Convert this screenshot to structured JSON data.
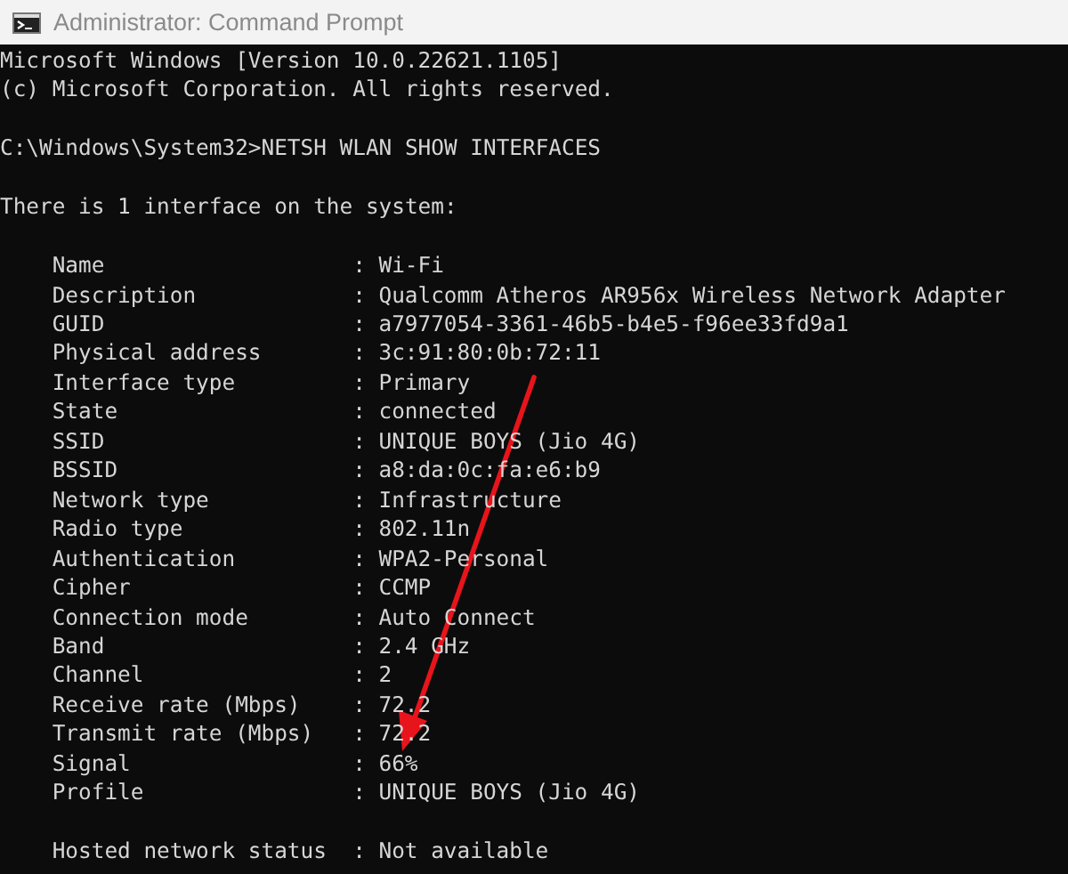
{
  "window": {
    "title": "Administrator: Command Prompt"
  },
  "console": {
    "header_lines": [
      "Microsoft Windows [Version 10.0.22621.1105]",
      "(c) Microsoft Corporation. All rights reserved."
    ],
    "command": "C:\\Windows\\System32>NETSH WLAN SHOW INTERFACES",
    "summary": "There is 1 interface on the system:",
    "fields": [
      {
        "label": "Name",
        "separator": ":",
        "value": "Wi-Fi"
      },
      {
        "label": "Description",
        "separator": ":",
        "value": "Qualcomm Atheros AR956x Wireless Network Adapter"
      },
      {
        "label": "GUID",
        "separator": ":",
        "value": "a7977054-3361-46b5-b4e5-f96ee33fd9a1"
      },
      {
        "label": "Physical address",
        "separator": ":",
        "value": "3c:91:80:0b:72:11"
      },
      {
        "label": "Interface type",
        "separator": ":",
        "value": "Primary"
      },
      {
        "label": "State",
        "separator": ":",
        "value": "connected"
      },
      {
        "label": "SSID",
        "separator": ":",
        "value": "UNIQUE BOYS (Jio 4G)"
      },
      {
        "label": "BSSID",
        "separator": ":",
        "value": "a8:da:0c:fa:e6:b9"
      },
      {
        "label": "Network type",
        "separator": ":",
        "value": "Infrastructure"
      },
      {
        "label": "Radio type",
        "separator": ":",
        "value": "802.11n"
      },
      {
        "label": "Authentication",
        "separator": ":",
        "value": "WPA2-Personal"
      },
      {
        "label": "Cipher",
        "separator": ":",
        "value": "CCMP"
      },
      {
        "label": "Connection mode",
        "separator": ":",
        "value": "Auto Connect"
      },
      {
        "label": "Band",
        "separator": ":",
        "value": "2.4 GHz"
      },
      {
        "label": "Channel",
        "separator": ":",
        "value": "2"
      },
      {
        "label": "Receive rate (Mbps)",
        "separator": ":",
        "value": "72.2"
      },
      {
        "label": "Transmit rate (Mbps)",
        "separator": ":",
        "value": "72.2"
      },
      {
        "label": "Signal",
        "separator": ":",
        "value": "66%"
      },
      {
        "label": "Profile",
        "separator": ":",
        "value": "UNIQUE BOYS (Jio 4G)"
      }
    ],
    "hosted": {
      "label": "Hosted network status",
      "separator": ":",
      "value": "Not available"
    }
  }
}
